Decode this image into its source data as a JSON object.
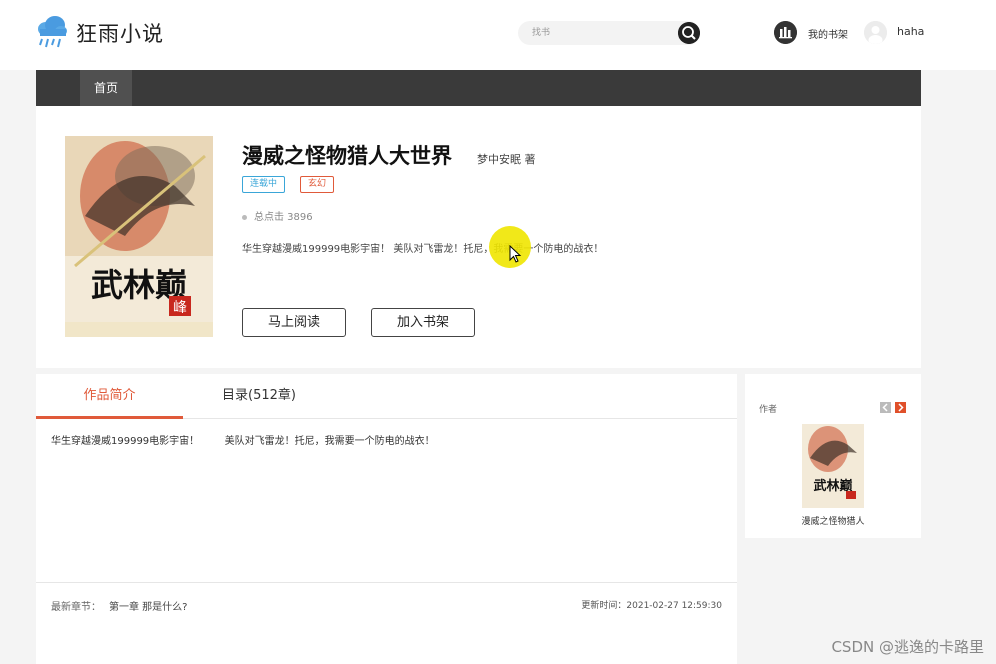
{
  "header": {
    "logo_text": "狂雨小说",
    "search_placeholder": "找书",
    "bookshelf_label": "我的书架",
    "user_name": "haha"
  },
  "nav": {
    "items": [
      "首页"
    ]
  },
  "book": {
    "title": "漫威之怪物猎人大世界",
    "author": "梦中安眠 著",
    "status_tag": "连载中",
    "genre_tag": "玄幻",
    "clicks": "总点击 3896",
    "description": "华生穿越漫威199999电影宇宙！ 美队对飞雷龙！托尼，我需要一个防电的战衣！",
    "read_button": "马上阅读",
    "add_shelf_button": "加入书架",
    "cover_text": "武林巅峰"
  },
  "tabs": {
    "intro": "作品简介",
    "toc": "目录(512章)"
  },
  "intro": {
    "text": "华生穿越漫威199999电影宇宙！        美队对飞雷龙！托尼，我需要一个防电的战衣！"
  },
  "latest": {
    "label": "最新章节：",
    "chapter": "第一章 那是什么?",
    "updated": "更新时间：2021-02-27 12:59:30"
  },
  "side": {
    "label": "作者",
    "book_title": "漫威之怪物猎人"
  },
  "watermark": "CSDN @逃逸的卡路里",
  "colors": {
    "accent": "#e05a3a",
    "status": "#3aa6d8",
    "nav_bg": "#3a3a3a"
  }
}
